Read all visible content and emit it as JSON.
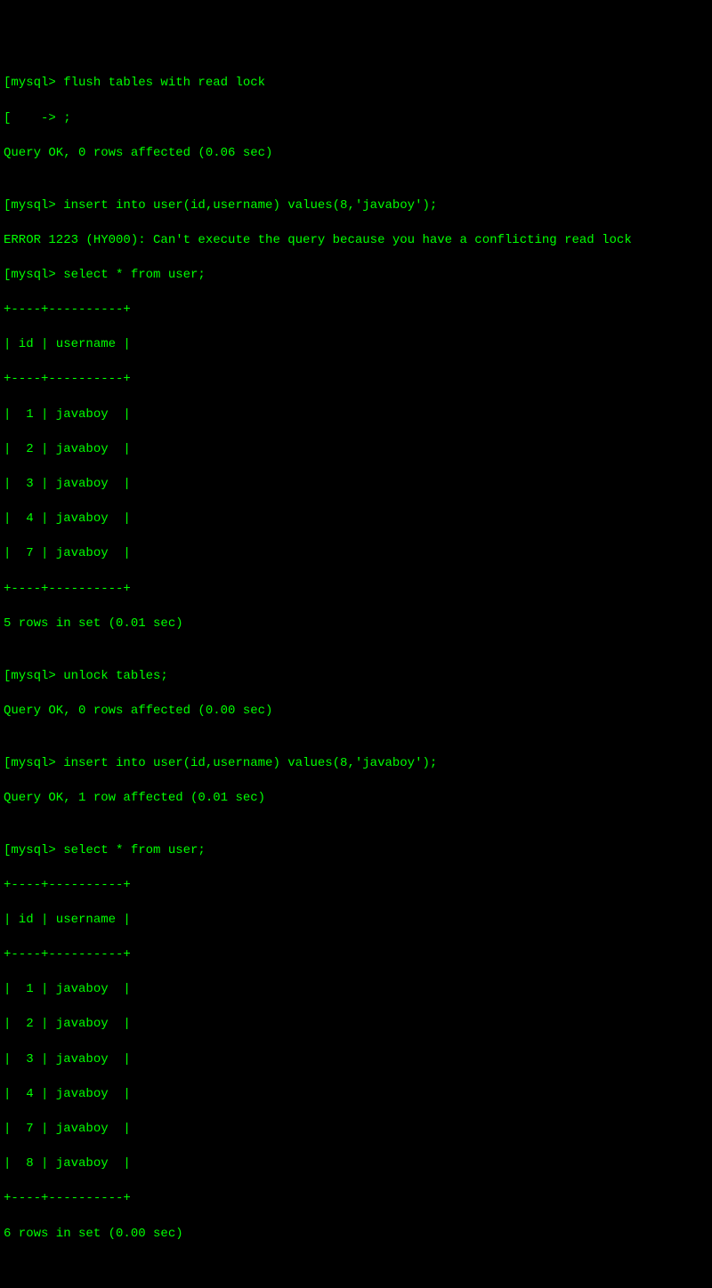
{
  "lines": {
    "l0": "[mysql> flush tables with read lock",
    "l1": "[    -> ;",
    "l2": "Query OK, 0 rows affected (0.06 sec)",
    "l3": "",
    "l4": "[mysql> insert into user(id,username) values(8,'javaboy');",
    "l5": "ERROR 1223 (HY000): Can't execute the query because you have a conflicting read lock",
    "l6": "[mysql> select * from user;",
    "l7": "+----+----------+",
    "l8": "| id | username |",
    "l9": "+----+----------+",
    "l10": "|  1 | javaboy  |",
    "l11": "|  2 | javaboy  |",
    "l12": "|  3 | javaboy  |",
    "l13": "|  4 | javaboy  |",
    "l14": "|  7 | javaboy  |",
    "l15": "+----+----------+",
    "l16": "5 rows in set (0.01 sec)",
    "l17": "",
    "l18": "[mysql> unlock tables;",
    "l19": "Query OK, 0 rows affected (0.00 sec)",
    "l20": "",
    "l21": "[mysql> insert into user(id,username) values(8,'javaboy');",
    "l22": "Query OK, 1 row affected (0.01 sec)",
    "l23": "",
    "l24": "[mysql> select * from user;",
    "l25": "+----+----------+",
    "l26": "| id | username |",
    "l27": "+----+----------+",
    "l28": "|  1 | javaboy  |",
    "l29": "|  2 | javaboy  |",
    "l30": "|  3 | javaboy  |",
    "l31": "|  4 | javaboy  |",
    "l32": "|  7 | javaboy  |",
    "l33": "|  8 | javaboy  |",
    "l34": "+----+----------+",
    "l35": "6 rows in set (0.00 sec)"
  }
}
